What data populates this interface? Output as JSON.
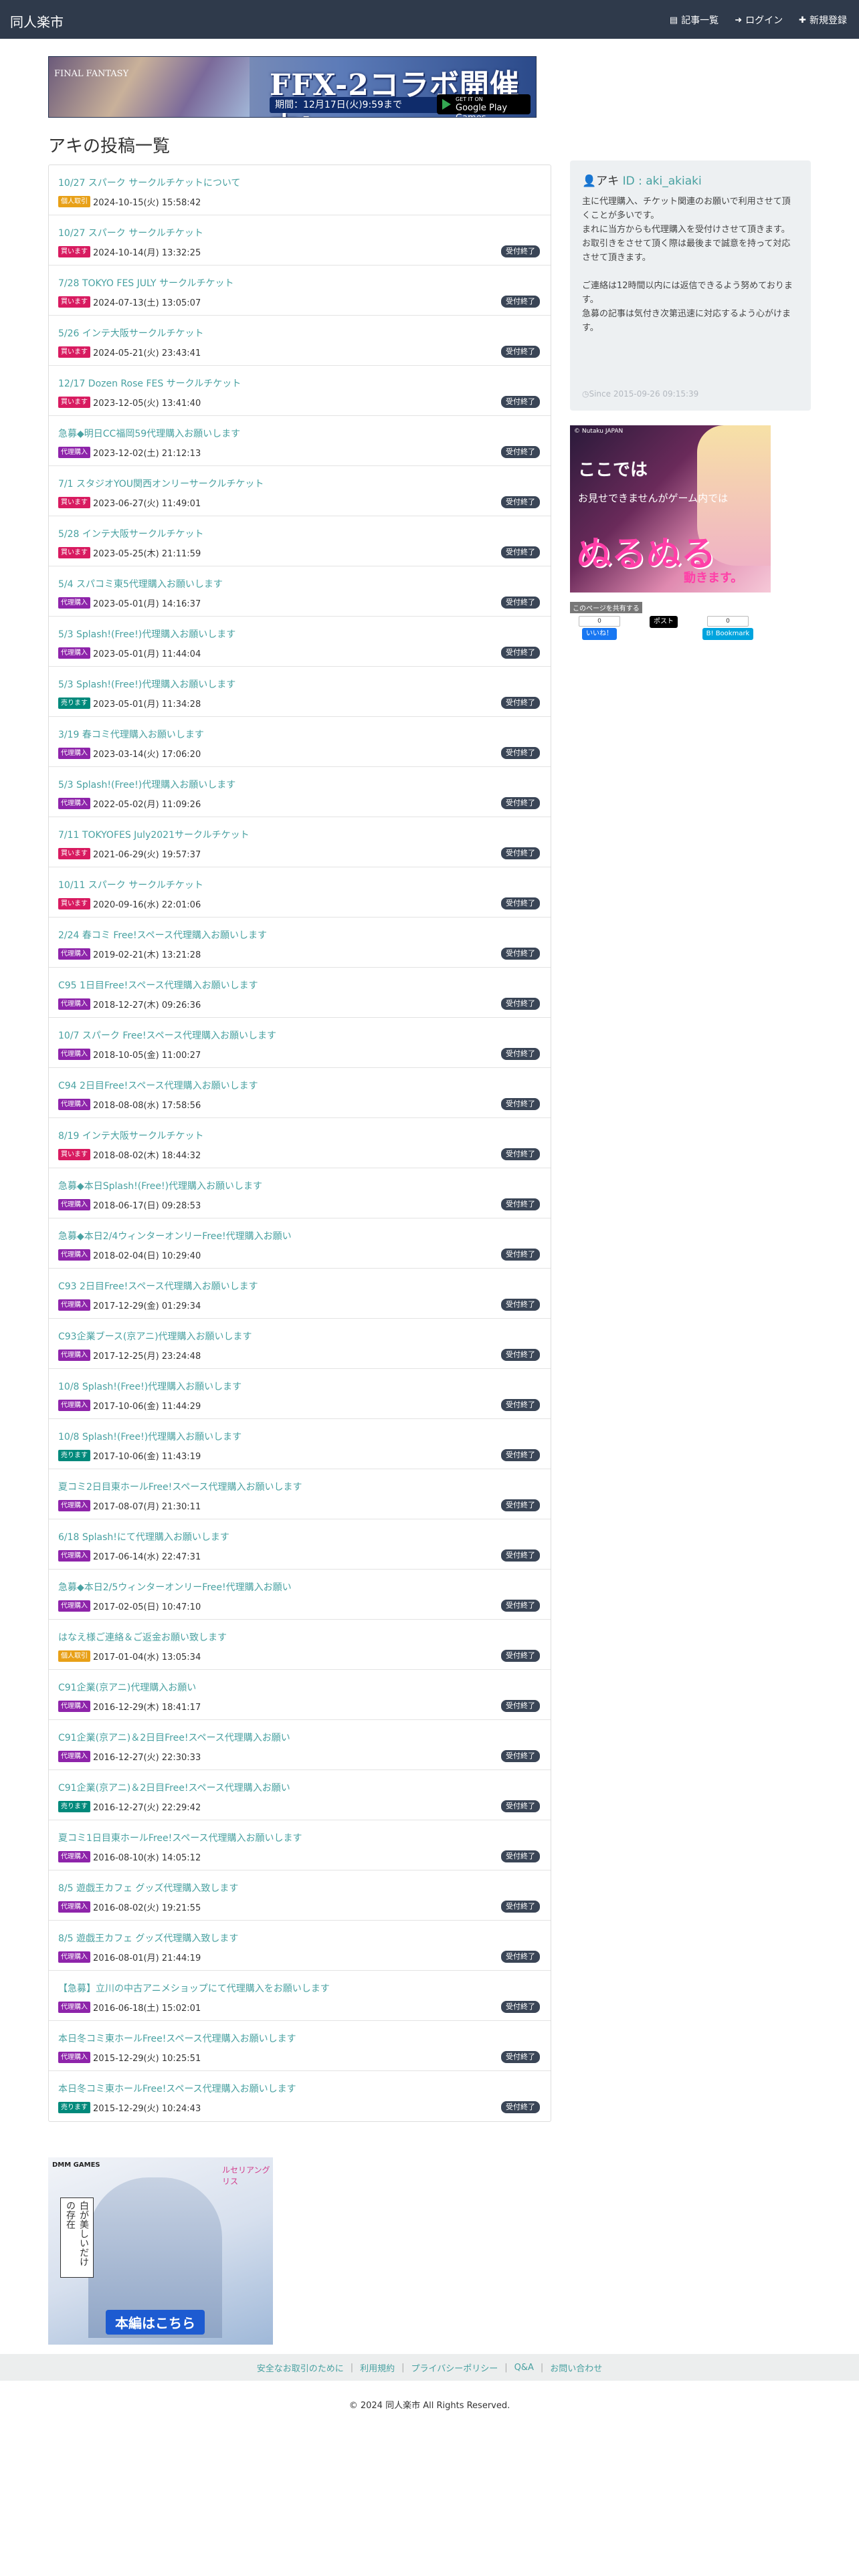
{
  "navbar": {
    "brand": "同人楽市",
    "items": [
      {
        "icon": "list-icon",
        "label": "記事一覧"
      },
      {
        "icon": "login-icon",
        "label": "ログイン"
      },
      {
        "icon": "plus-icon",
        "label": "新規登録"
      }
    ]
  },
  "top_banner": {
    "logo": "FINAL FANTASY",
    "headline": "FFX-2コラボ開催中!",
    "period": "期間：12月17日(火)9:59まで",
    "store_small": "GET IT ON",
    "store_big": "Google Play Games"
  },
  "page_title": "アキの投稿一覧",
  "posts": [
    {
      "title": "10/27 スパーク サークルチケットについて",
      "type": "個人取引",
      "type_color": "#e8a017",
      "date": "2024-10-15(火) 15:58:42",
      "status": ""
    },
    {
      "title": "10/27 スパーク サークルチケット",
      "type": "買います",
      "type_color": "#d81b60",
      "date": "2024-10-14(月) 13:32:25",
      "status": "受付終了"
    },
    {
      "title": "7/28 TOKYO FES JULY サークルチケット",
      "type": "買います",
      "type_color": "#d81b60",
      "date": "2024-07-13(土) 13:05:07",
      "status": "受付終了"
    },
    {
      "title": "5/26 インテ大阪サークルチケット",
      "type": "買います",
      "type_color": "#d81b60",
      "date": "2024-05-21(火) 23:43:41",
      "status": "受付終了"
    },
    {
      "title": "12/17 Dozen Rose FES サークルチケット",
      "type": "買います",
      "type_color": "#d81b60",
      "date": "2023-12-05(火) 13:41:40",
      "status": "受付終了"
    },
    {
      "title": "急募◆明日CC福岡59代理購入お願いします",
      "type": "代理購入",
      "type_color": "#8e24aa",
      "date": "2023-12-02(土) 21:12:13",
      "status": "受付終了"
    },
    {
      "title": "7/1 スタジオYOU関西オンリーサークルチケット",
      "type": "買います",
      "type_color": "#d81b60",
      "date": "2023-06-27(火) 11:49:01",
      "status": "受付終了"
    },
    {
      "title": "5/28 インテ大阪サークルチケット",
      "type": "買います",
      "type_color": "#d81b60",
      "date": "2023-05-25(木) 21:11:59",
      "status": "受付終了"
    },
    {
      "title": "5/4 スパコミ東5代理購入お願いします",
      "type": "代理購入",
      "type_color": "#8e24aa",
      "date": "2023-05-01(月) 14:16:37",
      "status": "受付終了"
    },
    {
      "title": "5/3 Splash!(Free!)代理購入お願いします",
      "type": "代理購入",
      "type_color": "#8e24aa",
      "date": "2023-05-01(月) 11:44:04",
      "status": "受付終了"
    },
    {
      "title": "5/3 Splash!(Free!)代理購入お願いします",
      "type": "売ります",
      "type_color": "#00897b",
      "date": "2023-05-01(月) 11:34:28",
      "status": "受付終了"
    },
    {
      "title": "3/19 春コミ代理購入お願いします",
      "type": "代理購入",
      "type_color": "#8e24aa",
      "date": "2023-03-14(火) 17:06:20",
      "status": "受付終了"
    },
    {
      "title": "5/3 Splash!(Free!)代理購入お願いします",
      "type": "代理購入",
      "type_color": "#8e24aa",
      "date": "2022-05-02(月) 11:09:26",
      "status": "受付終了"
    },
    {
      "title": "7/11 TOKYOFES July2021サークルチケット",
      "type": "買います",
      "type_color": "#d81b60",
      "date": "2021-06-29(火) 19:57:37",
      "status": "受付終了"
    },
    {
      "title": "10/11 スパーク サークルチケット",
      "type": "買います",
      "type_color": "#d81b60",
      "date": "2020-09-16(水) 22:01:06",
      "status": "受付終了"
    },
    {
      "title": "2/24 春コミ Free!スペース代理購入お願いします",
      "type": "代理購入",
      "type_color": "#8e24aa",
      "date": "2019-02-21(木) 13:21:28",
      "status": "受付終了"
    },
    {
      "title": "C95 1日目Free!スペース代理購入お願いします",
      "type": "代理購入",
      "type_color": "#8e24aa",
      "date": "2018-12-27(木) 09:26:36",
      "status": "受付終了"
    },
    {
      "title": "10/7 スパーク Free!スペース代理購入お願いします",
      "type": "代理購入",
      "type_color": "#8e24aa",
      "date": "2018-10-05(金) 11:00:27",
      "status": "受付終了"
    },
    {
      "title": "C94 2日目Free!スペース代理購入お願いします",
      "type": "代理購入",
      "type_color": "#8e24aa",
      "date": "2018-08-08(水) 17:58:56",
      "status": "受付終了"
    },
    {
      "title": "8/19 インテ大阪サークルチケット",
      "type": "買います",
      "type_color": "#d81b60",
      "date": "2018-08-02(木) 18:44:32",
      "status": "受付終了"
    },
    {
      "title": "急募◆本日Splash!(Free!)代理購入お願いします",
      "type": "代理購入",
      "type_color": "#8e24aa",
      "date": "2018-06-17(日) 09:28:53",
      "status": "受付終了"
    },
    {
      "title": "急募◆本日2/4ウィンターオンリーFree!代理購入お願い",
      "type": "代理購入",
      "type_color": "#8e24aa",
      "date": "2018-02-04(日) 10:29:40",
      "status": "受付終了"
    },
    {
      "title": "C93 2日目Free!スペース代理購入お願いします",
      "type": "代理購入",
      "type_color": "#8e24aa",
      "date": "2017-12-29(金) 01:29:34",
      "status": "受付終了"
    },
    {
      "title": "C93企業ブース(京アニ)代理購入お願いします",
      "type": "代理購入",
      "type_color": "#8e24aa",
      "date": "2017-12-25(月) 23:24:48",
      "status": "受付終了"
    },
    {
      "title": "10/8 Splash!(Free!)代理購入お願いします",
      "type": "代理購入",
      "type_color": "#8e24aa",
      "date": "2017-10-06(金) 11:44:29",
      "status": "受付終了"
    },
    {
      "title": "10/8 Splash!(Free!)代理購入お願いします",
      "type": "売ります",
      "type_color": "#00897b",
      "date": "2017-10-06(金) 11:43:19",
      "status": "受付終了"
    },
    {
      "title": "夏コミ2日目東ホールFree!スペース代理購入お願いします",
      "type": "代理購入",
      "type_color": "#8e24aa",
      "date": "2017-08-07(月) 21:30:11",
      "status": "受付終了"
    },
    {
      "title": "6/18 Splash!にて代理購入お願いします",
      "type": "代理購入",
      "type_color": "#8e24aa",
      "date": "2017-06-14(水) 22:47:31",
      "status": "受付終了"
    },
    {
      "title": "急募◆本日2/5ウィンターオンリーFree!代理購入お願い",
      "type": "代理購入",
      "type_color": "#8e24aa",
      "date": "2017-02-05(日) 10:47:10",
      "status": "受付終了"
    },
    {
      "title": "はなえ様ご連絡＆ご返金お願い致します",
      "type": "個人取引",
      "type_color": "#e8a017",
      "date": "2017-01-04(水) 13:05:34",
      "status": "受付終了"
    },
    {
      "title": "C91企業(京アニ)代理購入お願い",
      "type": "代理購入",
      "type_color": "#8e24aa",
      "date": "2016-12-29(木) 18:41:17",
      "status": "受付終了"
    },
    {
      "title": "C91企業(京アニ)＆2日目Free!スペース代理購入お願い",
      "type": "代理購入",
      "type_color": "#8e24aa",
      "date": "2016-12-27(火) 22:30:33",
      "status": "受付終了"
    },
    {
      "title": "C91企業(京アニ)＆2日目Free!スペース代理購入お願い",
      "type": "売ります",
      "type_color": "#00897b",
      "date": "2016-12-27(火) 22:29:42",
      "status": "受付終了"
    },
    {
      "title": "夏コミ1日目東ホールFree!スペース代理購入お願いします",
      "type": "代理購入",
      "type_color": "#8e24aa",
      "date": "2016-08-10(水) 14:05:12",
      "status": "受付終了"
    },
    {
      "title": "8/5 遊戯王カフェ グッズ代理購入致します",
      "type": "代理購入",
      "type_color": "#8e24aa",
      "date": "2016-08-02(火) 19:21:55",
      "status": "受付終了"
    },
    {
      "title": "8/5 遊戯王カフェ グッズ代理購入致します",
      "type": "代理購入",
      "type_color": "#8e24aa",
      "date": "2016-08-01(月) 21:44:19",
      "status": "受付終了"
    },
    {
      "title": "【急募】立川の中古アニメショップにて代理購入をお願いします",
      "type": "代理購入",
      "type_color": "#8e24aa",
      "date": "2016-06-18(土) 15:02:01",
      "status": "受付終了"
    },
    {
      "title": "本日冬コミ東ホールFree!スペース代理購入お願いします",
      "type": "代理購入",
      "type_color": "#8e24aa",
      "date": "2015-12-29(火) 10:25:51",
      "status": "受付終了"
    },
    {
      "title": "本日冬コミ東ホールFree!スペース代理購入お願いします",
      "type": "売ります",
      "type_color": "#00897b",
      "date": "2015-12-29(火) 10:24:43",
      "status": "受付終了"
    }
  ],
  "profile": {
    "name": "アキ",
    "id_text": "ID : aki_akiaki",
    "bio": "主に代理購入、チケット関連のお願いで利用させて頂くことが多いです。\nまれに当方からも代理購入を受付けさせて頂きます。\nお取引きをさせて頂く際は最後まで誠意を持って対応させて頂きます。\n\nご連絡は12時間以内には返信できるよう努めております。\n急募の記事は気付き次第迅速に対応するよう心がけます。",
    "since": "Since 2015-09-26 09:15:39"
  },
  "side_ad": {
    "top": "© Nutaku JAPAN",
    "line1": "ここでは",
    "line2": "お見せできませんがゲーム内では",
    "big": "ぬるぬる",
    "sub": "動きます。"
  },
  "share": {
    "label": "このページを共有する",
    "fb_count": "0",
    "fb_label": "いいね！",
    "tw_label": "ポスト",
    "hb_count": "0",
    "hb_label": "B! Bookmark"
  },
  "bottom_ad": {
    "dmm": "DMM GAMES",
    "brand": "ルセリアングリス",
    "side": "白が美しいだけの存在",
    "cta": "本編はこちら"
  },
  "footer": {
    "links": [
      "安全なお取引のために",
      "利用規約",
      "プライバシーポリシー",
      "Q&A",
      "お問い合わせ"
    ],
    "copyright": "© 2024 同人楽市 All Rights Reserved."
  },
  "colors": {
    "navbar": "#2f3a4b",
    "link": "#48a1a1",
    "status_badge": "#3a4556"
  }
}
